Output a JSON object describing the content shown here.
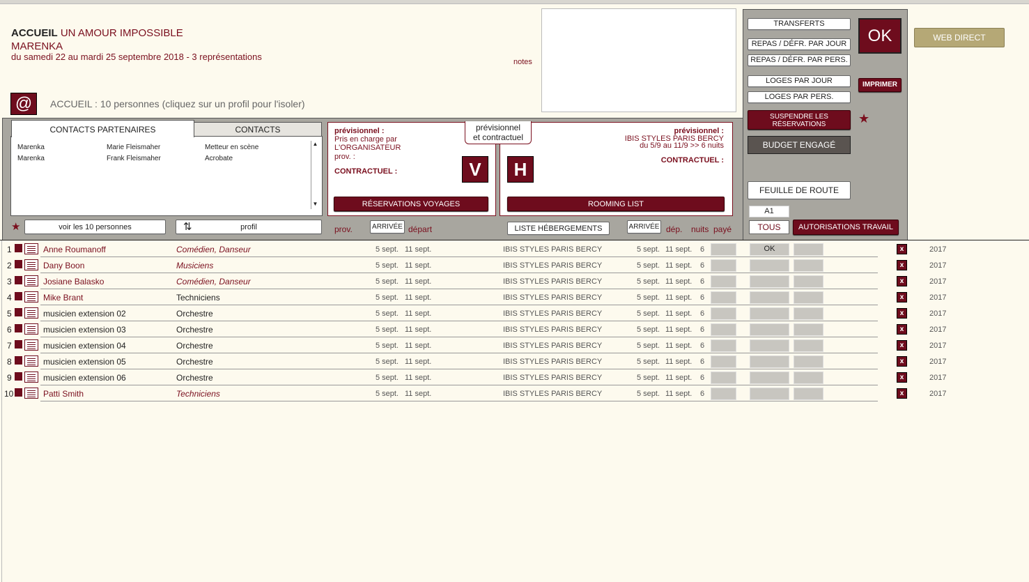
{
  "header": {
    "section": "ACCUEIL",
    "show_title": "UN AMOUR IMPOSSIBLE",
    "company": "MARENKA",
    "dates": "du samedi 22 au mardi 25 septembre 2018 - 3 représentations",
    "notes_label": "notes",
    "at_symbol": "@",
    "accueil_info": "ACCUEIL : 10 personnes (cliquez sur un profil pour l'isoler)"
  },
  "right_panel": {
    "transferts": "TRANSFERTS",
    "repas_jour": "REPAS / DÉFR. PAR JOUR",
    "repas_pers": "REPAS / DÉFR. PAR PERS.",
    "loges_jour": "LOGES PAR JOUR",
    "loges_pers": "LOGES PAR PERS.",
    "suspendre": "SUSPENDRE LES RÉSERVATIONS",
    "budget": "BUDGET ENGAGÉ",
    "feuille": "FEUILLE DE ROUTE",
    "a1_value": "A1",
    "tous": "TOUS",
    "autorisations": "AUTORISATIONS TRAVAIL",
    "ok": "OK",
    "imprimer": "IMPRIMER",
    "web_direct": "WEB DIRECT",
    "star": "★"
  },
  "contacts": {
    "tab_partenaires": "CONTACTS PARTENAIRES",
    "tab_contacts": "CONTACTS",
    "rows": [
      {
        "company": "Marenka",
        "name": "Marie Fleismaher",
        "role": "Metteur en scène"
      },
      {
        "company": "Marenka",
        "name": "Frank Fleismaher",
        "role": "Acrobate"
      }
    ],
    "voir_btn": "voir les 10 personnes",
    "profil_btn": "profil",
    "sort_glyph": "⇅",
    "star": "★"
  },
  "voyages": {
    "prev_label": "prévisionnel :",
    "prise_charge": "Pris en charge par",
    "organisateur": "L'ORGANISATEUR",
    "prov": "prov. :",
    "contractuel": "CONTRACTUEL :",
    "v_letter": "V",
    "toggle_line1": "prévisionnel",
    "toggle_line2": "et contractuel",
    "reservations_btn": "RÉSERVATIONS VOYAGES"
  },
  "hebergement": {
    "prev_label": "prévisionnel :",
    "hotel": "IBIS STYLES PARIS BERCY",
    "period": "du 5/9 au 11/9 >>  6 nuits",
    "contractuel": "CONTRACTUEL :",
    "h_letter": "H",
    "rooming_btn": "ROOMING LIST"
  },
  "columns": {
    "prov": "prov.",
    "arrivee1": "ARRIVÉE",
    "depart": "départ",
    "liste_heb": "LISTE HÉBERGEMENTS",
    "arrivee2": "ARRIVÉE",
    "dep": "dép.",
    "nuits": "nuits",
    "paye": "payé"
  },
  "people": [
    {
      "num": "1",
      "name": "Anne Roumanoff",
      "role": "Comédien, Danseur",
      "italic": true,
      "arr": "5 sept.",
      "dep": "11 sept.",
      "hotel": "IBIS STYLES PARIS BERCY",
      "h_arr": "5 sept.",
      "h_dep": "11 sept.",
      "nights": "6",
      "status": "OK",
      "year": "2017"
    },
    {
      "num": "2",
      "name": "Dany Boon",
      "role": "Musiciens",
      "italic": true,
      "arr": "5 sept.",
      "dep": "11 sept.",
      "hotel": "IBIS STYLES PARIS BERCY",
      "h_arr": "5 sept.",
      "h_dep": "11 sept.",
      "nights": "6",
      "status": "",
      "year": "2017"
    },
    {
      "num": "3",
      "name": "Josiane Balasko",
      "role": "Comédien, Danseur",
      "italic": true,
      "arr": "5 sept.",
      "dep": "11 sept.",
      "hotel": "IBIS STYLES PARIS BERCY",
      "h_arr": "5 sept.",
      "h_dep": "11 sept.",
      "nights": "6",
      "status": "",
      "year": "2017"
    },
    {
      "num": "4",
      "name": "Mike Brant",
      "role": "Techniciens",
      "italic": false,
      "arr": "5 sept.",
      "dep": "11 sept.",
      "hotel": "IBIS STYLES PARIS BERCY",
      "h_arr": "5 sept.",
      "h_dep": "11 sept.",
      "nights": "6",
      "status": "",
      "year": "2017"
    },
    {
      "num": "5",
      "name": "musicien extension 02",
      "role": "Orchestre",
      "italic": false,
      "arr": "5 sept.",
      "dep": "11 sept.",
      "hotel": "IBIS STYLES PARIS BERCY",
      "h_arr": "5 sept.",
      "h_dep": "11 sept.",
      "nights": "6",
      "status": "",
      "year": "2017"
    },
    {
      "num": "6",
      "name": "musicien extension 03",
      "role": "Orchestre",
      "italic": false,
      "arr": "5 sept.",
      "dep": "11 sept.",
      "hotel": "IBIS STYLES PARIS BERCY",
      "h_arr": "5 sept.",
      "h_dep": "11 sept.",
      "nights": "6",
      "status": "",
      "year": "2017"
    },
    {
      "num": "7",
      "name": "musicien extension 04",
      "role": "Orchestre",
      "italic": false,
      "arr": "5 sept.",
      "dep": "11 sept.",
      "hotel": "IBIS STYLES PARIS BERCY",
      "h_arr": "5 sept.",
      "h_dep": "11 sept.",
      "nights": "6",
      "status": "",
      "year": "2017"
    },
    {
      "num": "8",
      "name": "musicien extension 05",
      "role": "Orchestre",
      "italic": false,
      "arr": "5 sept.",
      "dep": "11 sept.",
      "hotel": "IBIS STYLES PARIS BERCY",
      "h_arr": "5 sept.",
      "h_dep": "11 sept.",
      "nights": "6",
      "status": "",
      "year": "2017"
    },
    {
      "num": "9",
      "name": "musicien extension 06",
      "role": "Orchestre",
      "italic": false,
      "arr": "5 sept.",
      "dep": "11 sept.",
      "hotel": "IBIS STYLES PARIS BERCY",
      "h_arr": "5 sept.",
      "h_dep": "11 sept.",
      "nights": "6",
      "status": "",
      "year": "2017"
    },
    {
      "num": "10",
      "name": "Patti Smith",
      "role": "Techniciens",
      "italic": true,
      "arr": "5 sept.",
      "dep": "11 sept.",
      "hotel": "IBIS STYLES PARIS BERCY",
      "h_arr": "5 sept.",
      "h_dep": "11 sept.",
      "nights": "6",
      "status": "",
      "year": "2017"
    }
  ],
  "delete_glyph": "x",
  "colors": {
    "accent": "#6e0c1d",
    "panel_gray": "#a8a69f",
    "background": "#fdfaee",
    "web_direct": "#b5a876"
  }
}
